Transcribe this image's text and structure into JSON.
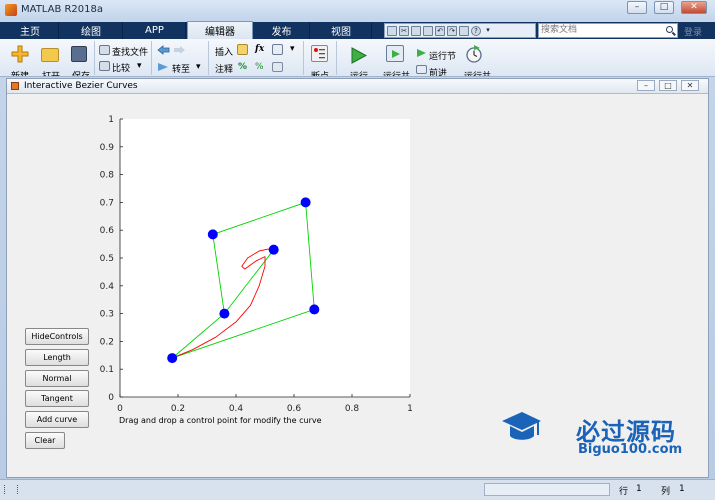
{
  "window": {
    "title": "MATLAB R2018a",
    "minimize": "–",
    "maximize": "□",
    "close": "✕"
  },
  "tabs": [
    "主页",
    "绘图",
    "APP",
    "编辑器",
    "发布",
    "视图"
  ],
  "active_tab": "编辑器",
  "search": {
    "placeholder": "搜索文档"
  },
  "corner_label": "登录",
  "ribbon": {
    "new": "新建",
    "open": "打开",
    "save": "保存",
    "find_files": "查找文件",
    "compare": "比较",
    "goto": "转至",
    "insert": "插入",
    "fx": "fx",
    "comment": "注释",
    "percent": "%",
    "breakpoints": "断点",
    "run": "运行",
    "run_advance": "运行并",
    "run_section": "运行节",
    "advance": "前进",
    "run_time": "运行并"
  },
  "figure": {
    "title": "Interactive Bezier Curves",
    "note": "Drag and drop a control point for modify the curve",
    "buttons": [
      "HideControls",
      "Length",
      "Normal",
      "Tangent",
      "Add curve",
      "Clear"
    ]
  },
  "chart_data": {
    "type": "scatter",
    "xlim": [
      0,
      1
    ],
    "ylim": [
      0,
      1
    ],
    "xticks": [
      "0",
      "0.2",
      "0.4",
      "0.6",
      "0.8",
      "1"
    ],
    "yticks": [
      "0",
      "0.1",
      "0.2",
      "0.3",
      "0.4",
      "0.5",
      "0.6",
      "0.7",
      "0.8",
      "0.9",
      "1"
    ],
    "grid": false,
    "control_polygon_1": [
      [
        0.18,
        0.14
      ],
      [
        0.36,
        0.3
      ],
      [
        0.32,
        0.585
      ],
      [
        0.64,
        0.7
      ],
      [
        0.67,
        0.315
      ],
      [
        0.18,
        0.14
      ]
    ],
    "control_polygon_2": [
      [
        0.36,
        0.3
      ],
      [
        0.53,
        0.53
      ]
    ],
    "control_points": [
      [
        0.18,
        0.14
      ],
      [
        0.36,
        0.3
      ],
      [
        0.32,
        0.585
      ],
      [
        0.64,
        0.7
      ],
      [
        0.67,
        0.315
      ],
      [
        0.53,
        0.53
      ]
    ],
    "curve": [
      [
        0.18,
        0.14
      ],
      [
        0.25,
        0.17
      ],
      [
        0.33,
        0.215
      ],
      [
        0.4,
        0.27
      ],
      [
        0.45,
        0.33
      ],
      [
        0.48,
        0.4
      ],
      [
        0.5,
        0.47
      ],
      [
        0.5,
        0.505
      ],
      [
        0.47,
        0.49
      ],
      [
        0.43,
        0.46
      ],
      [
        0.42,
        0.47
      ],
      [
        0.44,
        0.5
      ],
      [
        0.48,
        0.525
      ],
      [
        0.51,
        0.532
      ],
      [
        0.53,
        0.53
      ]
    ],
    "colors": {
      "polygon": "#00d400",
      "points": "#0000ff",
      "curve": "#ff0000"
    }
  },
  "status": {
    "row_label": "行",
    "row_value": "1",
    "col_label": "列",
    "col_value": "1"
  },
  "watermark": {
    "cn": "必过源码",
    "en": "Biguo100.com"
  }
}
